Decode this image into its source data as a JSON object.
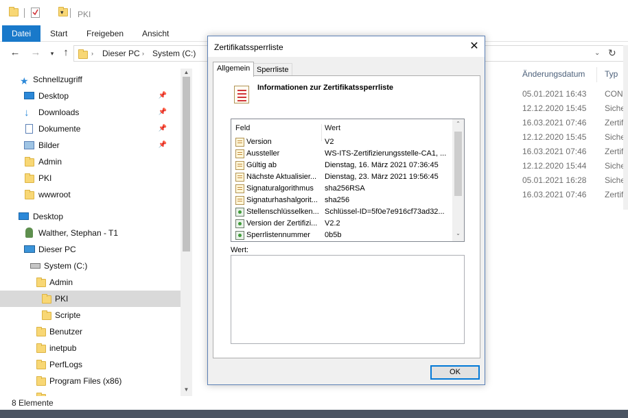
{
  "explorer": {
    "title": "PKI",
    "ribbon_tabs": [
      "Datei",
      "Start",
      "Freigeben",
      "Ansicht"
    ],
    "breadcrumb": [
      "Dieser PC",
      "System (C:)"
    ],
    "columns": {
      "date": "Änderungsdatum",
      "type": "Typ"
    },
    "files": [
      {
        "date": "05.01.2021 16:43",
        "type": "CONFI"
      },
      {
        "date": "12.12.2020 15:45",
        "type": "Sicherl"
      },
      {
        "date": "16.03.2021 07:46",
        "type": "Zertifik"
      },
      {
        "date": "12.12.2020 15:45",
        "type": "Sicherl"
      },
      {
        "date": "16.03.2021 07:46",
        "type": "Zertifik"
      },
      {
        "date": "12.12.2020 15:44",
        "type": "Sicherl"
      },
      {
        "date": "05.01.2021 16:28",
        "type": "Sicherl"
      },
      {
        "date": "16.03.2021 07:46",
        "type": "Zertifik"
      }
    ],
    "nav": [
      {
        "label": "Schnellzugriff",
        "icon": "star-icon"
      },
      {
        "label": "Desktop",
        "icon": "desktop-icon",
        "pinned": true
      },
      {
        "label": "Downloads",
        "icon": "download-icon",
        "pinned": true
      },
      {
        "label": "Dokumente",
        "icon": "document-icon",
        "pinned": true
      },
      {
        "label": "Bilder",
        "icon": "pictures-icon",
        "pinned": true
      },
      {
        "label": "Admin",
        "icon": "folder-icon"
      },
      {
        "label": "PKI",
        "icon": "folder-icon"
      },
      {
        "label": "wwwroot",
        "icon": "folder-icon"
      },
      {
        "label": "Desktop",
        "icon": "desktop-icon"
      },
      {
        "label": "Walther, Stephan - T1",
        "icon": "user-icon"
      },
      {
        "label": "Dieser PC",
        "icon": "pc-icon"
      },
      {
        "label": "System (C:)",
        "icon": "drive-icon"
      },
      {
        "label": "Admin",
        "icon": "folder-icon"
      },
      {
        "label": "PKI",
        "icon": "folder-icon",
        "selected": true
      },
      {
        "label": "Scripte",
        "icon": "folder-icon"
      },
      {
        "label": "Benutzer",
        "icon": "folder-icon"
      },
      {
        "label": "inetpub",
        "icon": "folder-icon"
      },
      {
        "label": "PerfLogs",
        "icon": "folder-icon"
      },
      {
        "label": "Program Files (x86)",
        "icon": "folder-icon"
      }
    ],
    "status": "8 Elemente"
  },
  "dialog": {
    "title": "Zertifikatssperrliste",
    "tabs": [
      "Allgemein",
      "Sperrliste"
    ],
    "active_tab": "Allgemein",
    "heading": "Informationen zur Zertifikatssperrliste",
    "columns": {
      "field": "Feld",
      "value": "Wert"
    },
    "rows": [
      {
        "field": "Version",
        "value": "V2",
        "kind": "cert"
      },
      {
        "field": "Aussteller",
        "value": "WS-ITS-Zertifizierungsstelle-CA1, ...",
        "kind": "cert"
      },
      {
        "field": "Gültig ab",
        "value": "Dienstag, 16. März 2021 07:36:45",
        "kind": "cert"
      },
      {
        "field": "Nächste Aktualisier...",
        "value": "Dienstag, 23. März 2021 19:56:45",
        "kind": "cert"
      },
      {
        "field": "Signaturalgorithmus",
        "value": "sha256RSA",
        "kind": "cert"
      },
      {
        "field": "Signaturhashalgorit...",
        "value": "sha256",
        "kind": "cert"
      },
      {
        "field": "Stellenschlüsselken...",
        "value": "Schlüssel-ID=5f0e7e916cf73ad32...",
        "kind": "ext"
      },
      {
        "field": "Version der Zertifizi...",
        "value": "V2.2",
        "kind": "ext"
      },
      {
        "field": "Sperrlistennummer",
        "value": "0b5b",
        "kind": "ext"
      }
    ],
    "value_label": "Wert:",
    "value_text": "",
    "ok_label": "OK"
  }
}
